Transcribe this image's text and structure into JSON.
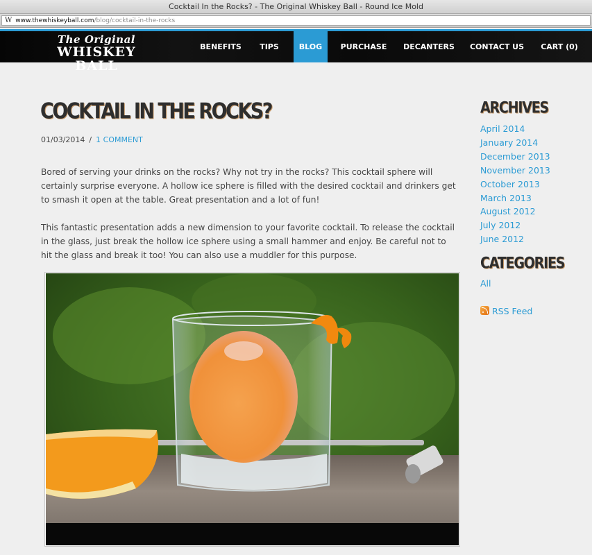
{
  "browser": {
    "window_title": "Cocktail In the Rocks? - The Original Whiskey Ball - Round Ice Mold",
    "url_host": "www.thewhiskeyball.com",
    "url_path": "/blog/cocktail-in-the-rocks",
    "favicon_glyph": "W"
  },
  "site": {
    "logo_line1": "The Original",
    "logo_line2": "WHISKEY BALL",
    "accent_color": "#2b9bd4"
  },
  "nav": {
    "items": [
      {
        "label": "BENEFITS",
        "active": false
      },
      {
        "label": "TIPS",
        "active": false
      },
      {
        "label": "BLOG",
        "active": true
      },
      {
        "label": "PURCHASE",
        "active": false
      },
      {
        "label": "DECANTERS",
        "active": false
      },
      {
        "label": "CONTACT US",
        "active": false
      },
      {
        "label": "CART (0)",
        "active": false
      }
    ]
  },
  "post": {
    "title": "COCKTAIL IN THE ROCKS?",
    "date": "01/03/2014",
    "separator": "/",
    "comments_link": "1 COMMENT",
    "paragraphs": [
      "Bored of serving your drinks on the rocks? Why not try in the rocks? This cocktail sphere will certainly surprise everyone. A hollow ice sphere is filled with the desired cocktail and drinkers get to smash it open at the table. Great presentation and a lot of fun!",
      "This fantastic presentation adds a new dimension to your favorite cocktail. To release the cocktail in the glass, just break the hollow ice sphere using a small hammer and enjoy. Be careful not to hit the glass and break it too!  You can also use a muddler for this purpose."
    ],
    "image_alt": "Orange cocktail inside a hollow ice sphere in a rocks glass with orange twist, orange wedge and small steel hammer"
  },
  "sidebar": {
    "archives_heading": "ARCHIVES",
    "archives": [
      "April 2014",
      "January 2014",
      "December 2013",
      "November 2013",
      "October 2013",
      "March 2013",
      "August 2012",
      "July 2012",
      "June 2012"
    ],
    "categories_heading": "CATEGORIES",
    "categories": [
      "All"
    ],
    "rss_label": "RSS Feed"
  }
}
